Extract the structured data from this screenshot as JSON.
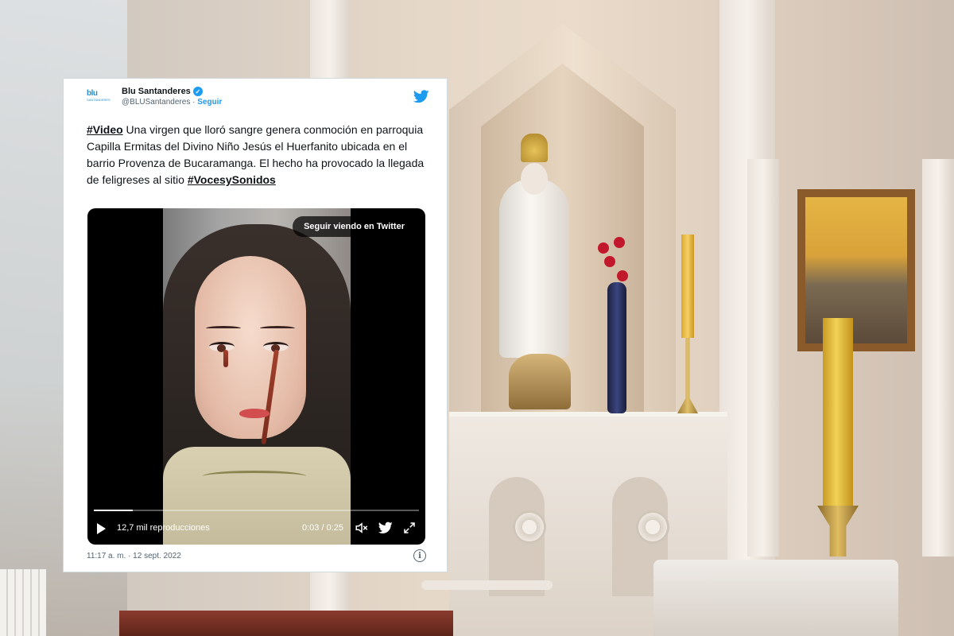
{
  "tweet": {
    "author_name": "Blu Santanderes",
    "avatar_logo": "blu",
    "avatar_subtext": "SANTANDERES",
    "handle": "@BLUSantanderes",
    "separator": "·",
    "follow_label": "Seguir",
    "text_hashtag_1": "#Video",
    "text_body": " Una virgen que lloró sangre genera conmoción en parroquia Capilla Ermitas del Divino Niño Jesús el Huerfanito ubicada en el barrio Provenza de Bucaramanga. El hecho ha provocado la llegada de feligreses al sitio ",
    "text_hashtag_2": "#VocesySonidos",
    "timestamp": "11:17 a. m. · 12 sept. 2022"
  },
  "video": {
    "overlay_button_label": "Seguir viendo en Twitter",
    "views": "12,7 mil reproducciones",
    "time": "0:03 / 0:25",
    "progress_fraction": 0.12
  },
  "icons": {
    "twitter": "twitter-bird-icon",
    "verified": "verified-badge-icon",
    "play": "play-icon",
    "volume": "volume-icon",
    "fullscreen": "fullscreen-icon",
    "info": "info-icon"
  },
  "colors": {
    "twitter_blue": "#1d9bf0",
    "text_primary": "#0f1419",
    "text_secondary": "#536471",
    "card_border": "#cfd9de"
  }
}
